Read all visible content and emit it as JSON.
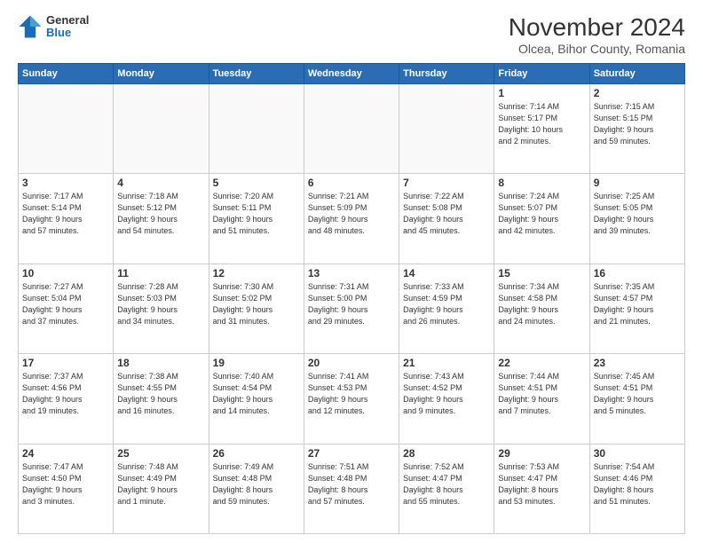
{
  "logo": {
    "general": "General",
    "blue": "Blue"
  },
  "title": "November 2024",
  "subtitle": "Olcea, Bihor County, Romania",
  "weekdays": [
    "Sunday",
    "Monday",
    "Tuesday",
    "Wednesday",
    "Thursday",
    "Friday",
    "Saturday"
  ],
  "weeks": [
    [
      {
        "day": "",
        "info": ""
      },
      {
        "day": "",
        "info": ""
      },
      {
        "day": "",
        "info": ""
      },
      {
        "day": "",
        "info": ""
      },
      {
        "day": "",
        "info": ""
      },
      {
        "day": "1",
        "info": "Sunrise: 7:14 AM\nSunset: 5:17 PM\nDaylight: 10 hours\nand 2 minutes."
      },
      {
        "day": "2",
        "info": "Sunrise: 7:15 AM\nSunset: 5:15 PM\nDaylight: 9 hours\nand 59 minutes."
      }
    ],
    [
      {
        "day": "3",
        "info": "Sunrise: 7:17 AM\nSunset: 5:14 PM\nDaylight: 9 hours\nand 57 minutes."
      },
      {
        "day": "4",
        "info": "Sunrise: 7:18 AM\nSunset: 5:12 PM\nDaylight: 9 hours\nand 54 minutes."
      },
      {
        "day": "5",
        "info": "Sunrise: 7:20 AM\nSunset: 5:11 PM\nDaylight: 9 hours\nand 51 minutes."
      },
      {
        "day": "6",
        "info": "Sunrise: 7:21 AM\nSunset: 5:09 PM\nDaylight: 9 hours\nand 48 minutes."
      },
      {
        "day": "7",
        "info": "Sunrise: 7:22 AM\nSunset: 5:08 PM\nDaylight: 9 hours\nand 45 minutes."
      },
      {
        "day": "8",
        "info": "Sunrise: 7:24 AM\nSunset: 5:07 PM\nDaylight: 9 hours\nand 42 minutes."
      },
      {
        "day": "9",
        "info": "Sunrise: 7:25 AM\nSunset: 5:05 PM\nDaylight: 9 hours\nand 39 minutes."
      }
    ],
    [
      {
        "day": "10",
        "info": "Sunrise: 7:27 AM\nSunset: 5:04 PM\nDaylight: 9 hours\nand 37 minutes."
      },
      {
        "day": "11",
        "info": "Sunrise: 7:28 AM\nSunset: 5:03 PM\nDaylight: 9 hours\nand 34 minutes."
      },
      {
        "day": "12",
        "info": "Sunrise: 7:30 AM\nSunset: 5:02 PM\nDaylight: 9 hours\nand 31 minutes."
      },
      {
        "day": "13",
        "info": "Sunrise: 7:31 AM\nSunset: 5:00 PM\nDaylight: 9 hours\nand 29 minutes."
      },
      {
        "day": "14",
        "info": "Sunrise: 7:33 AM\nSunset: 4:59 PM\nDaylight: 9 hours\nand 26 minutes."
      },
      {
        "day": "15",
        "info": "Sunrise: 7:34 AM\nSunset: 4:58 PM\nDaylight: 9 hours\nand 24 minutes."
      },
      {
        "day": "16",
        "info": "Sunrise: 7:35 AM\nSunset: 4:57 PM\nDaylight: 9 hours\nand 21 minutes."
      }
    ],
    [
      {
        "day": "17",
        "info": "Sunrise: 7:37 AM\nSunset: 4:56 PM\nDaylight: 9 hours\nand 19 minutes."
      },
      {
        "day": "18",
        "info": "Sunrise: 7:38 AM\nSunset: 4:55 PM\nDaylight: 9 hours\nand 16 minutes."
      },
      {
        "day": "19",
        "info": "Sunrise: 7:40 AM\nSunset: 4:54 PM\nDaylight: 9 hours\nand 14 minutes."
      },
      {
        "day": "20",
        "info": "Sunrise: 7:41 AM\nSunset: 4:53 PM\nDaylight: 9 hours\nand 12 minutes."
      },
      {
        "day": "21",
        "info": "Sunrise: 7:43 AM\nSunset: 4:52 PM\nDaylight: 9 hours\nand 9 minutes."
      },
      {
        "day": "22",
        "info": "Sunrise: 7:44 AM\nSunset: 4:51 PM\nDaylight: 9 hours\nand 7 minutes."
      },
      {
        "day": "23",
        "info": "Sunrise: 7:45 AM\nSunset: 4:51 PM\nDaylight: 9 hours\nand 5 minutes."
      }
    ],
    [
      {
        "day": "24",
        "info": "Sunrise: 7:47 AM\nSunset: 4:50 PM\nDaylight: 9 hours\nand 3 minutes."
      },
      {
        "day": "25",
        "info": "Sunrise: 7:48 AM\nSunset: 4:49 PM\nDaylight: 9 hours\nand 1 minute."
      },
      {
        "day": "26",
        "info": "Sunrise: 7:49 AM\nSunset: 4:48 PM\nDaylight: 8 hours\nand 59 minutes."
      },
      {
        "day": "27",
        "info": "Sunrise: 7:51 AM\nSunset: 4:48 PM\nDaylight: 8 hours\nand 57 minutes."
      },
      {
        "day": "28",
        "info": "Sunrise: 7:52 AM\nSunset: 4:47 PM\nDaylight: 8 hours\nand 55 minutes."
      },
      {
        "day": "29",
        "info": "Sunrise: 7:53 AM\nSunset: 4:47 PM\nDaylight: 8 hours\nand 53 minutes."
      },
      {
        "day": "30",
        "info": "Sunrise: 7:54 AM\nSunset: 4:46 PM\nDaylight: 8 hours\nand 51 minutes."
      }
    ]
  ]
}
